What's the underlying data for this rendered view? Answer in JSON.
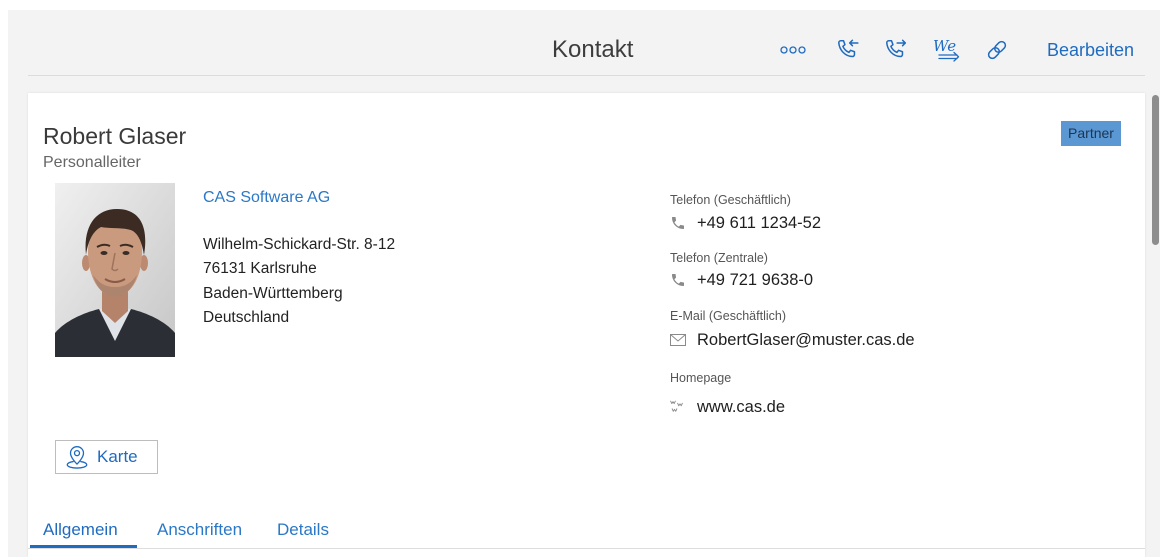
{
  "header": {
    "title": "Kontakt",
    "actions": [
      {
        "icon": "more-icon"
      },
      {
        "icon": "phone-incoming-icon"
      },
      {
        "icon": "phone-outgoing-icon"
      },
      {
        "icon": "web-arrow-icon",
        "glyph": "We"
      },
      {
        "icon": "link-icon"
      }
    ],
    "edit_label": "Bearbeiten"
  },
  "contact": {
    "name": "Robert Glaser",
    "position": "Personalleiter",
    "badge": "Partner",
    "company": "CAS Software AG",
    "address": [
      "Wilhelm-Schickard-Str. 8-12",
      "76131 Karlsruhe",
      "Baden-Württemberg",
      "Deutschland"
    ]
  },
  "details": [
    {
      "label": "Telefon (Geschäftlich)",
      "icon": "phone-icon",
      "value": "+49 611 1234-52"
    },
    {
      "label": "Telefon (Zentrale)",
      "icon": "phone-icon",
      "value": "+49 721 9638-0"
    },
    {
      "label": "E-Mail (Geschäftlich)",
      "icon": "mail-icon",
      "value": "RobertGlaser@muster.cas.de"
    },
    {
      "label": "Homepage",
      "icon": "www-icon",
      "value": "www.cas.de"
    }
  ],
  "map_button": {
    "icon": "map-pin-icon",
    "label": "Karte"
  },
  "tabs": [
    {
      "label": "Allgemein",
      "active": true
    },
    {
      "label": "Anschriften",
      "active": false
    },
    {
      "label": "Details",
      "active": false
    }
  ],
  "colors": {
    "accent": "#1f6bc0",
    "link": "#2a78c6",
    "badge_bg": "#5b98d3",
    "badge_text": "#1c3553",
    "icon_gray": "#8a8a8a"
  }
}
